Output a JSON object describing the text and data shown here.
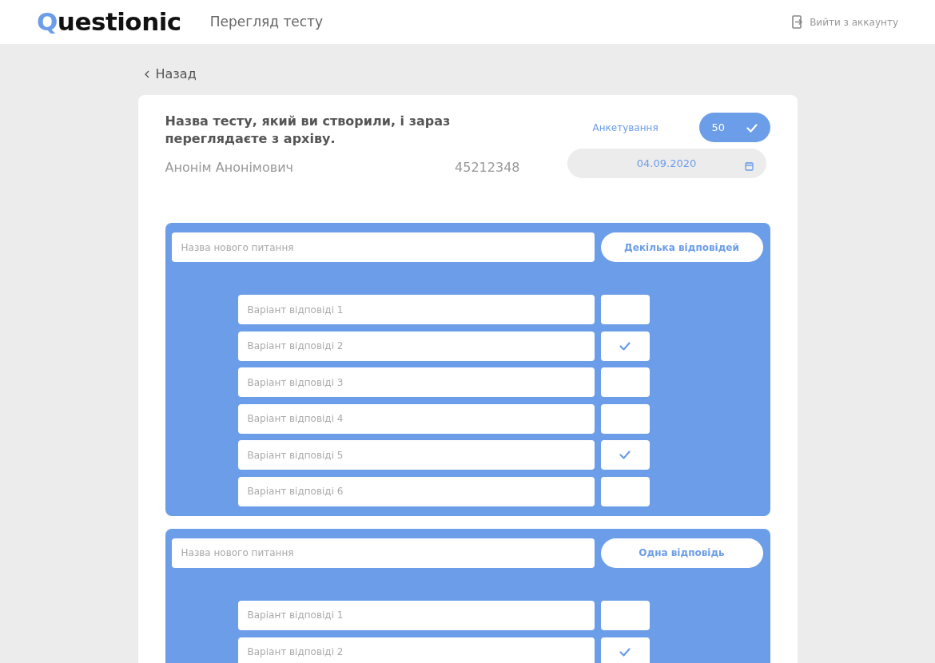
{
  "header": {
    "logo": "Questionic",
    "page_title": "Перегляд тесту",
    "logout": "Вийти з аккаунту"
  },
  "back": "Назад",
  "test": {
    "title": "Назва тесту, який ви створили, і зараз переглядаєте з архіву.",
    "author": "Анонім Анонімович",
    "number": "45212348",
    "type": "Анкетування",
    "points": "50",
    "points_confirmed": true,
    "date": "04.09.2020"
  },
  "questions": [
    {
      "placeholder": "Назва нового питання",
      "answer_type": "Декілька відповідей",
      "options": [
        {
          "placeholder": "Варіант відповіді 1",
          "checked": false
        },
        {
          "placeholder": "Варіант відповіді 2",
          "checked": true
        },
        {
          "placeholder": "Варіант відповіді 3",
          "checked": false
        },
        {
          "placeholder": "Варіант відповіді 4",
          "checked": false
        },
        {
          "placeholder": "Варіант відповіді 5",
          "checked": true
        },
        {
          "placeholder": "Варіант відповіді 6",
          "checked": false
        }
      ]
    },
    {
      "placeholder": "Назва нового питання",
      "answer_type": "Одна відповідь",
      "options": [
        {
          "placeholder": "Варіант відповіді 1",
          "checked": false
        },
        {
          "placeholder": "Варіант відповіді 2",
          "checked": true
        }
      ]
    }
  ]
}
